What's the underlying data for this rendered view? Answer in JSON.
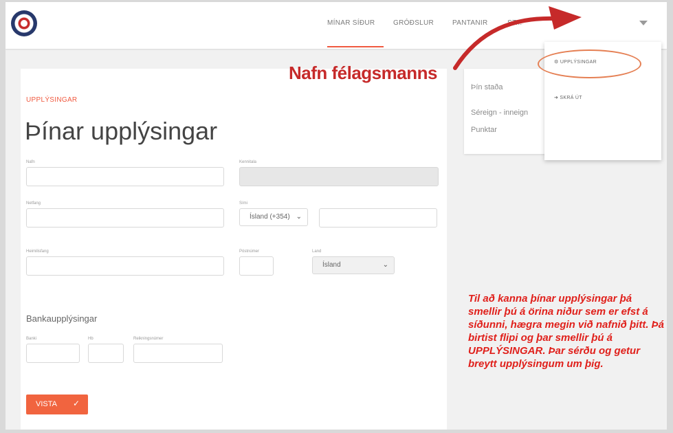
{
  "nav": [
    "MÍNAR SÍÐUR",
    "GRÓÐSLUR",
    "PANTANIR",
    "ST..."
  ],
  "dropdown": [
    "UPPLÝSINGAR",
    "SKRÁ ÚT"
  ],
  "annotation_title": "Nafn félagsmanns",
  "page": {
    "eyebrow": "UPPLÝSINGAR",
    "title": "Þínar upplýsingar",
    "labels": {
      "nafn": "Nafn",
      "kennitala": "Kennitala",
      "netfang": "Netfang",
      "simi": "Sími",
      "heimilisfang": "Heimilisfang",
      "postnumer": "Póstnúmer",
      "land": "Land",
      "banki": "Banki",
      "hb": "Hb",
      "reikningsnumer": "Reikningsnúmer"
    },
    "values": {
      "phone_country": "Ísland (+354)",
      "country": "Ísland"
    },
    "section_bank": "Bankaupplýsingar",
    "save": "VISTA"
  },
  "status": {
    "title": "Þín staða",
    "line1": "Séreign - inneign",
    "line2": "Punktar"
  },
  "note": "Til að kanna þínar upplýsingar þá smellir þú á örina niður sem er efst á síðunni, hægra megin við nafnið þitt. Þá birtist flipi og þar smellir þú á UPPLÝSINGAR. Þar sérðu og getur breytt upplýsingum um þig.",
  "colors": {
    "accent": "#f0593f",
    "annotation": "#c62a2a"
  },
  "icons": {
    "upplysingar": "gears-icon",
    "skra_ut": "logout-icon",
    "save": "check-icon"
  }
}
